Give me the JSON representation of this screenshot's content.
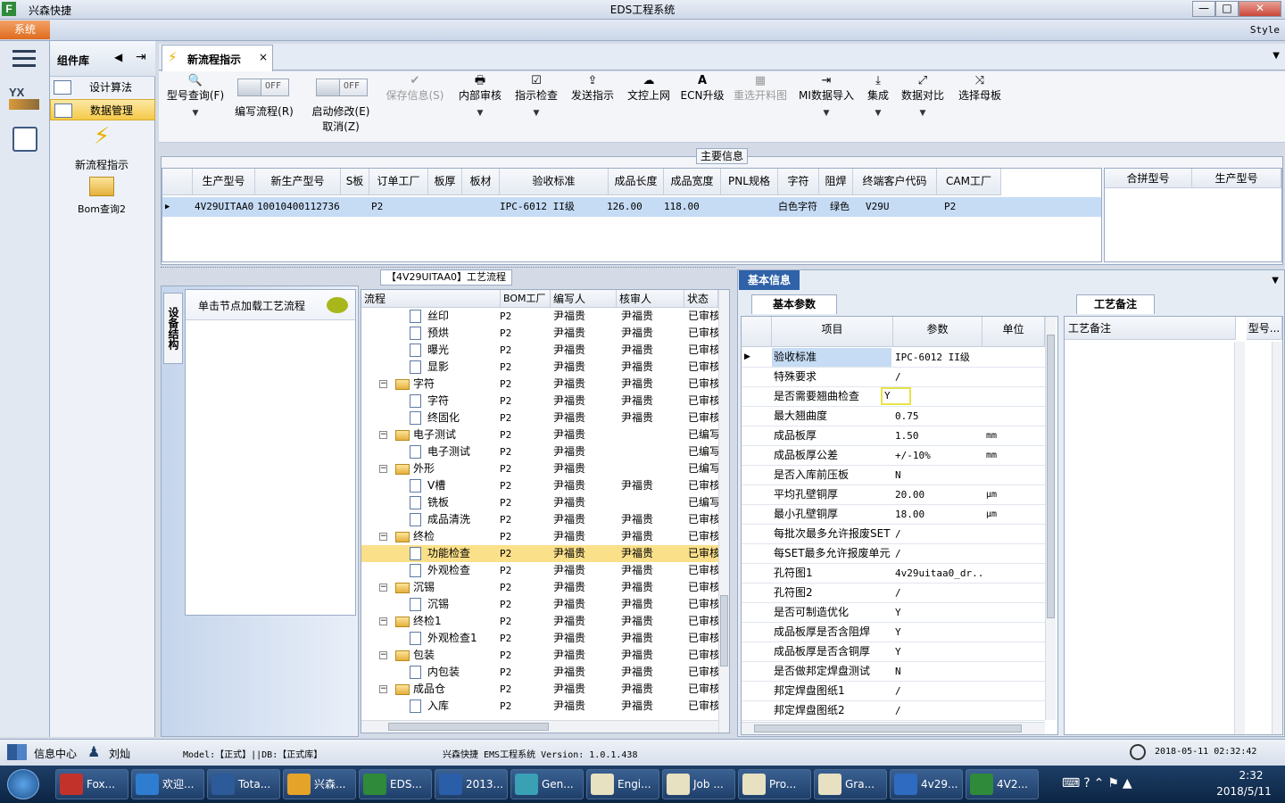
{
  "window": {
    "app_name": "兴森快捷",
    "title": "EDS工程系统",
    "min": "—",
    "max": "□",
    "close": "✕"
  },
  "menubar": {
    "system": "系统",
    "style": "Style"
  },
  "component_library": {
    "title": "组件库",
    "items": [
      {
        "label": "设计算法",
        "selected": false
      },
      {
        "label": "数据管理",
        "selected": true
      }
    ],
    "big_items": [
      {
        "label": "新流程指示"
      },
      {
        "label": "Bom查询2"
      }
    ]
  },
  "tab": {
    "label": "新流程指示",
    "close": "×"
  },
  "toolbar": {
    "buttons": [
      {
        "label": "型号查询(F)",
        "icon": "🔍",
        "dropdown": true,
        "disabled": false
      },
      {
        "label": "编写流程(R)",
        "toggle": "OFF"
      },
      {
        "label": "启动修改(E)",
        "label2": "取消(Z)",
        "toggle": "OFF"
      },
      {
        "label": "保存信息(S)",
        "icon": "✔",
        "disabled": true
      },
      {
        "label": "内部审核",
        "icon": "🖶",
        "dropdown": true
      },
      {
        "label": "指示检查",
        "icon": "☑",
        "dropdown": true
      },
      {
        "label": "发送指示",
        "icon": "⇪"
      },
      {
        "label": "文控上网",
        "icon": "☁"
      },
      {
        "label": "ECN升级",
        "icon": "A"
      },
      {
        "label": "重选开料图",
        "icon": "▦",
        "disabled": true
      },
      {
        "label": "MI数据导入",
        "icon": "⇥",
        "dropdown": true
      },
      {
        "label": "集成",
        "icon": "⤓",
        "dropdown": true
      },
      {
        "label": "数据对比",
        "icon": "⤢",
        "dropdown": true
      },
      {
        "label": "选择母板",
        "icon": "⤨"
      }
    ]
  },
  "main_info": {
    "group_title": "主要信息",
    "columns": [
      "生产型号",
      "新生产型号",
      "S板",
      "订单工厂",
      "板厚",
      "板材",
      "验收标准",
      "成品长度",
      "成品宽度",
      "PNL规格",
      "字符",
      "阻焊",
      "终端客户代码",
      "CAM工厂"
    ],
    "rows": [
      [
        "4V29UITAA0",
        "10010400112736",
        "",
        "P2",
        "",
        "",
        "IPC-6012 II级",
        "126.00",
        "118.00",
        "",
        "白色字符",
        "绿色",
        "V29U",
        "P2"
      ]
    ],
    "side_columns": [
      "合拼型号",
      "生产型号"
    ]
  },
  "process_flow": {
    "title": "【4V29UITAA0】工艺流程",
    "equip_tab": "设备结构",
    "load_node": "单击节点加载工艺流程",
    "columns": [
      "流程",
      "BOM工厂",
      "编写人",
      "核审人",
      "状态"
    ],
    "rows": [
      {
        "level": 2,
        "type": "doc",
        "name": "丝印",
        "bom": "P2",
        "writer": "尹福贵",
        "reviewer": "尹福贵",
        "status": "已审核"
      },
      {
        "level": 2,
        "type": "doc",
        "name": "预烘",
        "bom": "P2",
        "writer": "尹福贵",
        "reviewer": "尹福贵",
        "status": "已审核"
      },
      {
        "level": 2,
        "type": "doc",
        "name": "曝光",
        "bom": "P2",
        "writer": "尹福贵",
        "reviewer": "尹福贵",
        "status": "已审核"
      },
      {
        "level": 2,
        "type": "doc",
        "name": "显影",
        "bom": "P2",
        "writer": "尹福贵",
        "reviewer": "尹福贵",
        "status": "已审核"
      },
      {
        "level": 1,
        "type": "folder",
        "name": "字符",
        "bom": "P2",
        "writer": "尹福贵",
        "reviewer": "尹福贵",
        "status": "已审核"
      },
      {
        "level": 2,
        "type": "doc",
        "name": "字符",
        "bom": "P2",
        "writer": "尹福贵",
        "reviewer": "尹福贵",
        "status": "已审核"
      },
      {
        "level": 2,
        "type": "doc",
        "name": "终固化",
        "bom": "P2",
        "writer": "尹福贵",
        "reviewer": "尹福贵",
        "status": "已审核"
      },
      {
        "level": 1,
        "type": "folder",
        "name": "电子测试",
        "bom": "P2",
        "writer": "尹福贵",
        "reviewer": "",
        "status": "已编写"
      },
      {
        "level": 2,
        "type": "doc",
        "name": "电子测试",
        "bom": "P2",
        "writer": "尹福贵",
        "reviewer": "",
        "status": "已编写"
      },
      {
        "level": 1,
        "type": "folder",
        "name": "外形",
        "bom": "P2",
        "writer": "尹福贵",
        "reviewer": "",
        "status": "已编写"
      },
      {
        "level": 2,
        "type": "doc",
        "name": "V槽",
        "bom": "P2",
        "writer": "尹福贵",
        "reviewer": "尹福贵",
        "status": "已审核"
      },
      {
        "level": 2,
        "type": "doc",
        "name": "铣板",
        "bom": "P2",
        "writer": "尹福贵",
        "reviewer": "",
        "status": "已编写"
      },
      {
        "level": 2,
        "type": "doc",
        "name": "成品清洗",
        "bom": "P2",
        "writer": "尹福贵",
        "reviewer": "尹福贵",
        "status": "已审核"
      },
      {
        "level": 1,
        "type": "folder",
        "name": "终检",
        "bom": "P2",
        "writer": "尹福贵",
        "reviewer": "尹福贵",
        "status": "已审核"
      },
      {
        "level": 2,
        "type": "doc",
        "name": "功能检查",
        "bom": "P2",
        "writer": "尹福贵",
        "reviewer": "尹福贵",
        "status": "已审核",
        "selected": true
      },
      {
        "level": 2,
        "type": "doc",
        "name": "外观检查",
        "bom": "P2",
        "writer": "尹福贵",
        "reviewer": "尹福贵",
        "status": "已审核"
      },
      {
        "level": 1,
        "type": "folder",
        "name": "沉锡",
        "bom": "P2",
        "writer": "尹福贵",
        "reviewer": "尹福贵",
        "status": "已审核"
      },
      {
        "level": 2,
        "type": "doc",
        "name": "沉锡",
        "bom": "P2",
        "writer": "尹福贵",
        "reviewer": "尹福贵",
        "status": "已审核"
      },
      {
        "level": 1,
        "type": "folder",
        "name": "终检1",
        "bom": "P2",
        "writer": "尹福贵",
        "reviewer": "尹福贵",
        "status": "已审核"
      },
      {
        "level": 2,
        "type": "doc",
        "name": "外观检查1",
        "bom": "P2",
        "writer": "尹福贵",
        "reviewer": "尹福贵",
        "status": "已审核"
      },
      {
        "level": 1,
        "type": "folder",
        "name": "包装",
        "bom": "P2",
        "writer": "尹福贵",
        "reviewer": "尹福贵",
        "status": "已审核"
      },
      {
        "level": 2,
        "type": "doc",
        "name": "内包装",
        "bom": "P2",
        "writer": "尹福贵",
        "reviewer": "尹福贵",
        "status": "已审核"
      },
      {
        "level": 1,
        "type": "folder",
        "name": "成品仓",
        "bom": "P2",
        "writer": "尹福贵",
        "reviewer": "尹福贵",
        "status": "已审核"
      },
      {
        "level": 2,
        "type": "doc",
        "name": "入库",
        "bom": "P2",
        "writer": "尹福贵",
        "reviewer": "尹福贵",
        "status": "已审核"
      }
    ]
  },
  "basic_info": {
    "tab": "基本信息",
    "params_tab": "基本参数",
    "columns": [
      "项目",
      "参数",
      "单位"
    ],
    "rows": [
      {
        "key": "验收标准",
        "value": "IPC-6012 II级",
        "unit": "",
        "current": true
      },
      {
        "key": "特殊要求",
        "value": "/",
        "unit": ""
      },
      {
        "key": "是否需要翘曲检查",
        "value": "Y",
        "unit": "",
        "highlight": true
      },
      {
        "key": "最大翘曲度",
        "value": "0.75",
        "unit": ""
      },
      {
        "key": "成品板厚",
        "value": "1.50",
        "unit": "mm"
      },
      {
        "key": "成品板厚公差",
        "value": "+/-10%",
        "unit": "mm"
      },
      {
        "key": "是否入库前压板",
        "value": "N",
        "unit": ""
      },
      {
        "key": "平均孔壁铜厚",
        "value": "20.00",
        "unit": "μm"
      },
      {
        "key": "最小孔壁铜厚",
        "value": "18.00",
        "unit": "μm"
      },
      {
        "key": "每批次最多允许报废SET",
        "value": "/",
        "unit": ""
      },
      {
        "key": "每SET最多允许报废单元",
        "value": "/",
        "unit": ""
      },
      {
        "key": "孔符图1",
        "value": "4v29uitaa0_dr...",
        "unit": ""
      },
      {
        "key": "孔符图2",
        "value": "/",
        "unit": ""
      },
      {
        "key": "是否可制造优化",
        "value": "Y",
        "unit": ""
      },
      {
        "key": "成品板厚是否含阻焊",
        "value": "Y",
        "unit": ""
      },
      {
        "key": "成品板厚是否含铜厚",
        "value": "Y",
        "unit": ""
      },
      {
        "key": "是否做邦定焊盘测试",
        "value": "N",
        "unit": ""
      },
      {
        "key": "邦定焊盘图纸1",
        "value": "/",
        "unit": ""
      },
      {
        "key": "邦定焊盘图纸2",
        "value": "/",
        "unit": ""
      }
    ],
    "notes_tab": "工艺备注",
    "notes_columns": [
      "工艺备注",
      "型号..."
    ]
  },
  "status": {
    "info_center": "信息中心",
    "user": "刘灿",
    "model": "Model:【正式】||DB:【正式库】",
    "version": "兴森快捷 EMS工程系统 Version: 1.0.1.438",
    "datetime": "2018-05-11 02:32:42"
  },
  "taskbar": {
    "tasks": [
      "Fox...",
      "欢迎...",
      "Tota...",
      "兴森...",
      "EDS...",
      "2013...",
      "Gen...",
      "Engi...",
      "Job ...",
      "Pro...",
      "Gra...",
      "4v29...",
      "4V2..."
    ],
    "time": "2:32",
    "date": "2018/5/11"
  },
  "colors": {
    "accent": "#2f62a8",
    "selected_row": "#fbe08a",
    "system_menu": "#e06b1d",
    "current_row": "#c6dcf5"
  }
}
